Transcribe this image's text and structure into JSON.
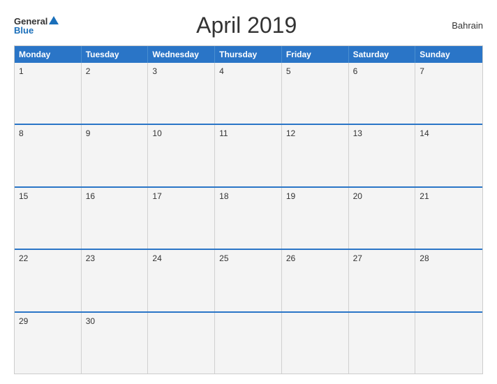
{
  "header": {
    "logo_general": "General",
    "logo_blue": "Blue",
    "title": "April 2019",
    "country": "Bahrain"
  },
  "weekdays": [
    "Monday",
    "Tuesday",
    "Wednesday",
    "Thursday",
    "Friday",
    "Saturday",
    "Sunday"
  ],
  "weeks": [
    [
      "1",
      "2",
      "3",
      "4",
      "5",
      "6",
      "7"
    ],
    [
      "8",
      "9",
      "10",
      "11",
      "12",
      "13",
      "14"
    ],
    [
      "15",
      "16",
      "17",
      "18",
      "19",
      "20",
      "21"
    ],
    [
      "22",
      "23",
      "24",
      "25",
      "26",
      "27",
      "28"
    ],
    [
      "29",
      "30",
      "",
      "",
      "",
      "",
      ""
    ]
  ]
}
